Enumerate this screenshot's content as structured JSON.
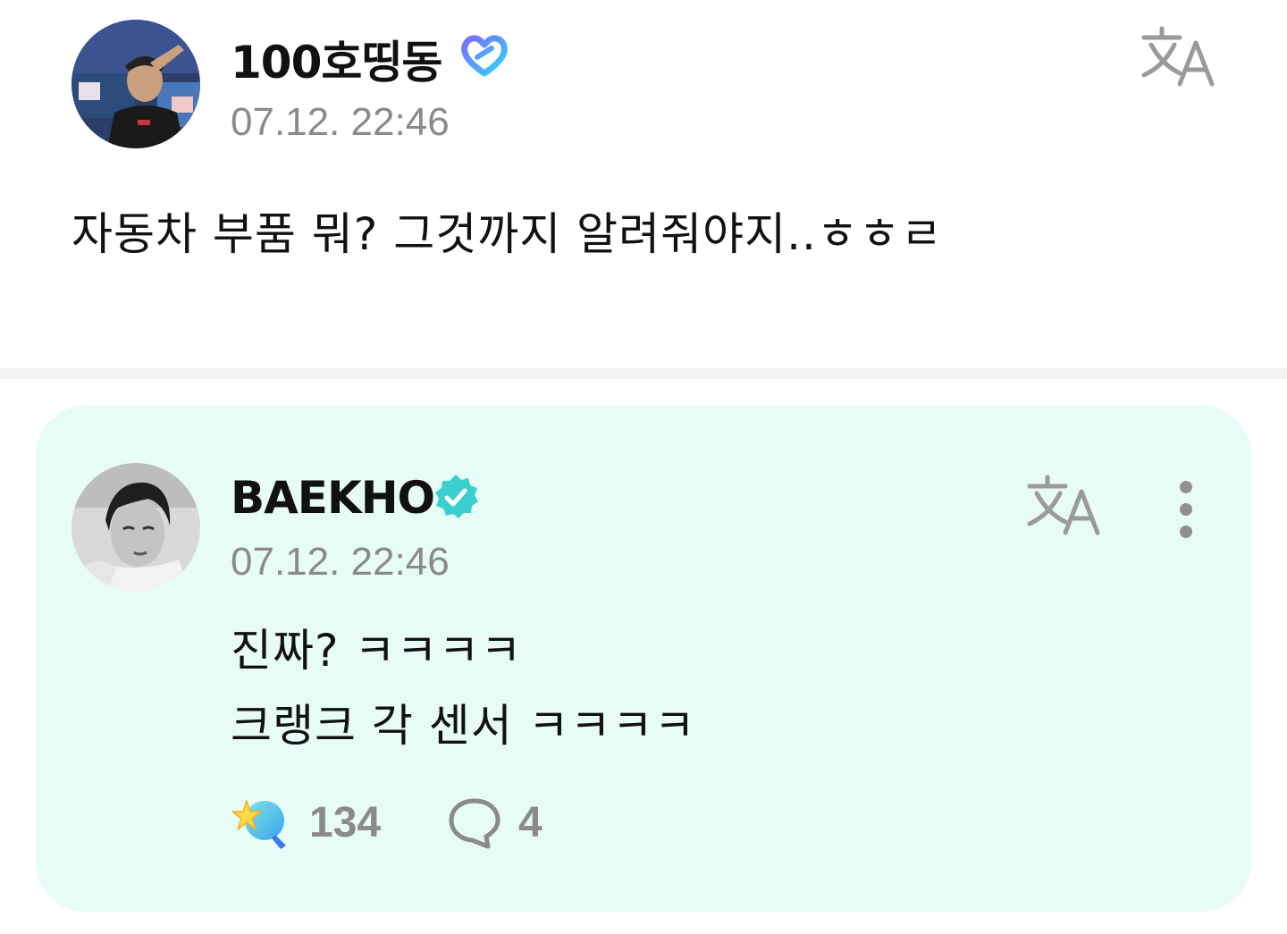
{
  "post": {
    "author": "100호띵동",
    "timestamp": "07.12. 22:46",
    "body": "자동차 부품 뭐? 그것까지 알려줘야지..ㅎㅎㄹ",
    "avatar_icon": "user-photo-avatar",
    "badge_icon": "heart-membership-badge-icon",
    "translate_icon": "translate-icon"
  },
  "reply": {
    "author": "BAEKHO",
    "timestamp": "07.12. 22:46",
    "lines": [
      "진짜? ㅋㅋㅋㅋ",
      "크랭크 각 센서 ㅋㅋㅋㅋ"
    ],
    "avatar_icon": "artist-photo-avatar",
    "badge_icon": "verified-check-badge-icon",
    "translate_icon": "translate-icon",
    "more_icon": "more-vertical-icon",
    "like_icon": "star-wand-like-icon",
    "like_count": "134",
    "comment_icon": "speech-bubble-comment-icon",
    "comment_count": "4"
  },
  "colors": {
    "card_background": "#e7fcf7",
    "divider": "#f3f3f5",
    "text_primary": "#111111",
    "text_secondary": "#8a8a8a",
    "verified_badge": "#3ccfcf",
    "membership_badge_start": "#7b6cff",
    "membership_badge_end": "#2fd5ff"
  }
}
